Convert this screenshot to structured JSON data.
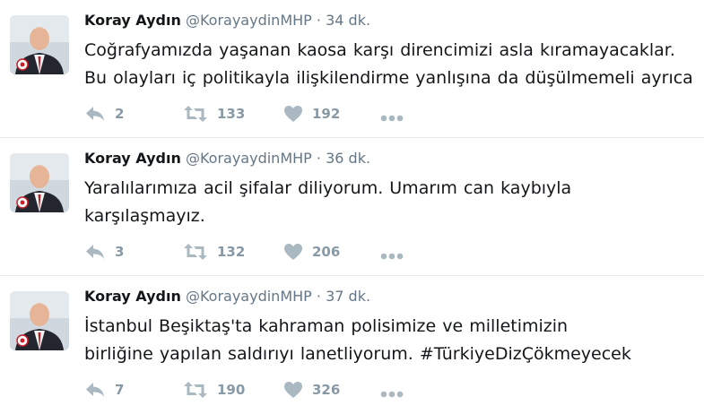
{
  "tweets": [
    {
      "name": "Koray Aydın",
      "handle": "@KorayaydinMHP",
      "separator": "·",
      "time": "34 dk.",
      "text": "Coğrafyamızda yaşanan kaosa karşı direncimizi asla kıramayacaklar. Bu olayları iç politikayla ilişkilendirme yanlışına da düşülmemeli ayrıca",
      "replies": "2",
      "retweets": "133",
      "likes": "192"
    },
    {
      "name": "Koray Aydın",
      "handle": "@KorayaydinMHP",
      "separator": "·",
      "time": "36 dk.",
      "text": "Yaralılarımıza acil şifalar diliyorum. Umarım can kaybıyla karşılaşmayız.",
      "replies": "3",
      "retweets": "132",
      "likes": "206"
    },
    {
      "name": "Koray Aydın",
      "handle": "@KorayaydinMHP",
      "separator": "·",
      "time": "37 dk.",
      "text": "İstanbul Beşiktaş'ta kahraman polisimize ve milletimizin birliğine yapılan saldırıyı lanetliyorum. #TürkiyeDizÇökmeyecek",
      "replies": "7",
      "retweets": "190",
      "likes": "326"
    }
  ],
  "colors": {
    "action_icon": "#aab8c2",
    "count": "#8899a6",
    "secondary_text": "#657786",
    "divider": "#e6ecf0"
  },
  "icons": [
    "avatar",
    "reply-icon",
    "retweet-icon",
    "like-icon",
    "more-icon"
  ]
}
